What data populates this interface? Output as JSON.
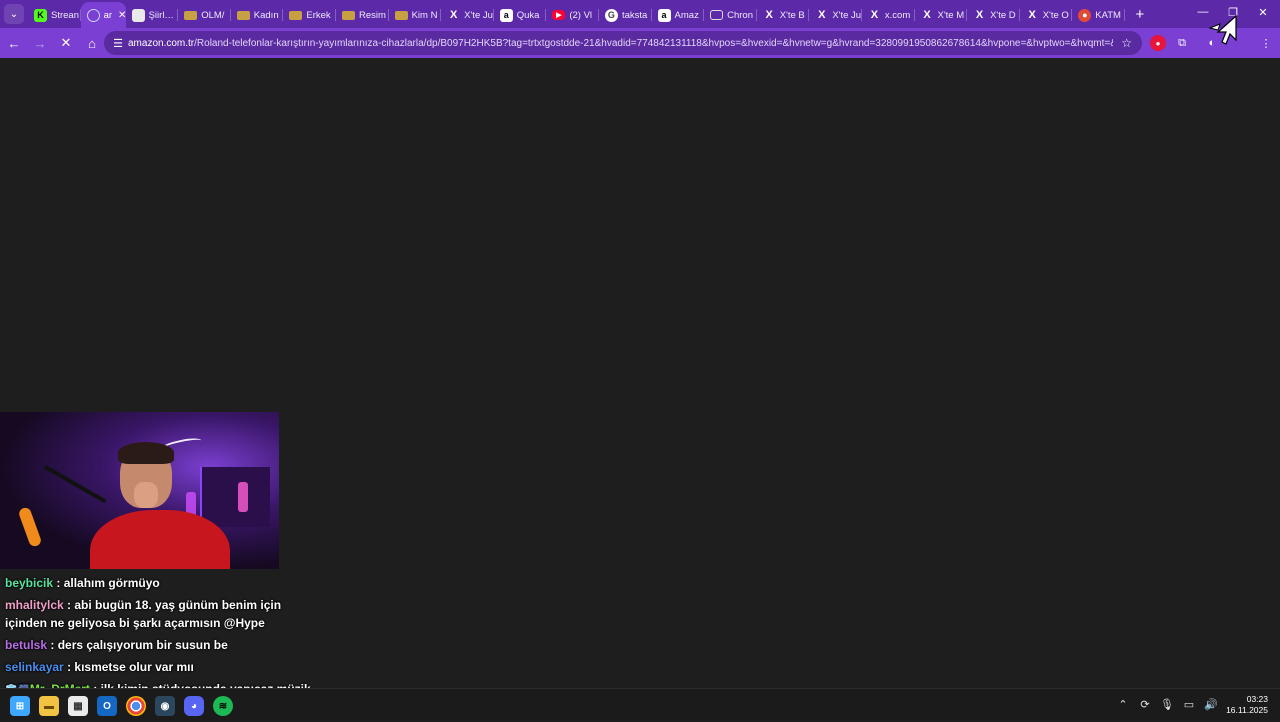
{
  "tabs": [
    {
      "label": "Strean",
      "icon": "kick-icon",
      "glyph": "K"
    },
    {
      "label": "ar",
      "icon": "arc-icon",
      "glyph": "",
      "active": true
    },
    {
      "label": "Şiirl…",
      "icon": "document-icon",
      "glyph": ""
    },
    {
      "label": "OLM/",
      "icon": "folder-icon",
      "glyph": ""
    },
    {
      "label": "Kadın",
      "icon": "folder-icon",
      "glyph": ""
    },
    {
      "label": "Erkek",
      "icon": "folder-icon",
      "glyph": ""
    },
    {
      "label": "Resim",
      "icon": "folder-icon",
      "glyph": ""
    },
    {
      "label": "Kim N",
      "icon": "folder-icon",
      "glyph": ""
    },
    {
      "label": "X'te Ju",
      "icon": "x-icon",
      "glyph": "X"
    },
    {
      "label": "Quka",
      "icon": "amazon-icon",
      "glyph": "a"
    },
    {
      "label": "(2) Vl",
      "icon": "youtube-icon",
      "glyph": "▶"
    },
    {
      "label": "taksta",
      "icon": "google-icon",
      "glyph": "G"
    },
    {
      "label": "Amaz",
      "icon": "amazon-icon",
      "glyph": "a"
    },
    {
      "label": "Chron",
      "icon": "camera-icon",
      "glyph": ""
    },
    {
      "label": "X'te B",
      "icon": "x-icon",
      "glyph": "X"
    },
    {
      "label": "X'te Ju",
      "icon": "x-icon",
      "glyph": "X"
    },
    {
      "label": "x.com",
      "icon": "x-icon",
      "glyph": "X"
    },
    {
      "label": "X'te M",
      "icon": "x-icon",
      "glyph": "X"
    },
    {
      "label": "X'te D",
      "icon": "x-icon",
      "glyph": "X"
    },
    {
      "label": "X'te O",
      "icon": "x-icon",
      "glyph": "X"
    },
    {
      "label": "KATM",
      "icon": "red-circle-icon",
      "glyph": "●"
    }
  ],
  "address": {
    "domain": "amazon.com.tr",
    "path": "/Roland-telefonlar-karıştırın-yayımlarınıza-cihazlarla/dp/B097H2HK5B?tag=trtxtgostdde-21&hvadid=774842131118&hvpos=&hvexid=&hvnetw=g&hvrand=3280991950862678614&hvpone=&hvptwo=&hvqmt=&hvdev=..."
  },
  "chat": [
    {
      "user": "beybicik",
      "text": ": allahım görmüyo",
      "color": "#56e39f"
    },
    {
      "user": "mhalitylck",
      "text": ": abi bugün 18. yaş günüm benim için içinden ne geliyosa bi şarkı açarmısın @Hype",
      "color": "#f0a0c8"
    },
    {
      "user": "betulsk",
      "text": ": ders çalışıyorum bir susun be",
      "color": "#b86ee8"
    },
    {
      "user": "selinkayar",
      "text": ": kısmetse olur var mıı",
      "color": "#4a8ef0"
    },
    {
      "user": "Mr_DrMert",
      "text": ": ilk kimin stüdyosunda yapıcaz müzik yayını ?",
      "color": "#7ee04a"
    }
  ],
  "taskbar": {
    "time": "03:23",
    "date": "16.11.2025"
  }
}
